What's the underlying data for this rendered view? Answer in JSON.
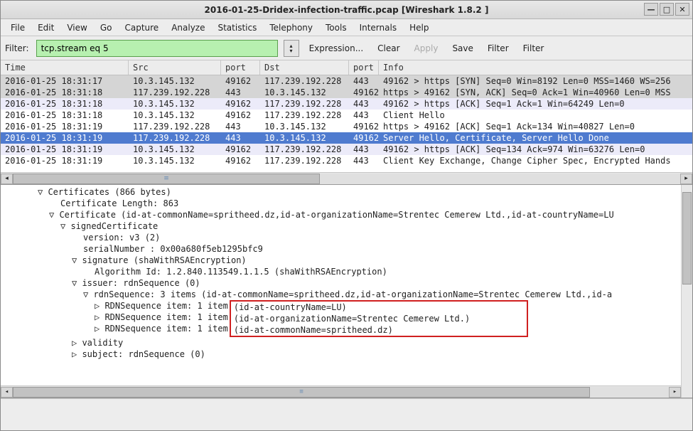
{
  "window": {
    "title": "2016-01-25-Dridex-infection-traffic.pcap   [Wireshark 1.8.2 ]"
  },
  "menu": {
    "items": [
      "File",
      "Edit",
      "View",
      "Go",
      "Capture",
      "Analyze",
      "Statistics",
      "Telephony",
      "Tools",
      "Internals",
      "Help"
    ]
  },
  "filter": {
    "label": "Filter:",
    "value": "tcp.stream eq 5",
    "expression": "Expression...",
    "clear": "Clear",
    "apply": "Apply",
    "save": "Save",
    "filter1": "Filter",
    "filter2": "Filter"
  },
  "packets": {
    "columns": [
      "Time",
      "Src",
      "port",
      "Dst",
      "port",
      "Info"
    ],
    "rows": [
      {
        "style": "row-gray",
        "c": [
          "2016-01-25 18:31:17",
          "10.3.145.132",
          "49162",
          "117.239.192.228",
          "443",
          "49162 > https [SYN] Seq=0 Win=8192 Len=0 MSS=1460 WS=256"
        ]
      },
      {
        "style": "row-gray",
        "c": [
          "2016-01-25 18:31:18",
          "117.239.192.228",
          "443",
          "10.3.145.132",
          "49162",
          "https > 49162 [SYN, ACK] Seq=0 Ack=1 Win=40960 Len=0 MSS"
        ]
      },
      {
        "style": "row-light",
        "c": [
          "2016-01-25 18:31:18",
          "10.3.145.132",
          "49162",
          "117.239.192.228",
          "443",
          "49162 > https [ACK] Seq=1 Ack=1 Win=64249 Len=0"
        ]
      },
      {
        "style": "row-white",
        "c": [
          "2016-01-25 18:31:18",
          "10.3.145.132",
          "49162",
          "117.239.192.228",
          "443",
          "Client Hello"
        ]
      },
      {
        "style": "row-white",
        "c": [
          "2016-01-25 18:31:19",
          "117.239.192.228",
          "443",
          "10.3.145.132",
          "49162",
          "https > 49162 [ACK] Seq=1 Ack=134 Win=40827 Len=0"
        ]
      },
      {
        "style": "row-sel",
        "c": [
          "2016-01-25 18:31:19",
          "117.239.192.228",
          "443",
          "10.3.145.132",
          "49162",
          "Server Hello, Certificate, Server Hello Done"
        ]
      },
      {
        "style": "row-light",
        "c": [
          "2016-01-25 18:31:19",
          "10.3.145.132",
          "49162",
          "117.239.192.228",
          "443",
          "49162 > https [ACK] Seq=134 Ack=974 Win=63276 Len=0"
        ]
      },
      {
        "style": "row-white",
        "c": [
          "2016-01-25 18:31:19",
          "10.3.145.132",
          "49162",
          "117.239.192.228",
          "443",
          "Client Key Exchange, Change Cipher Spec, Encrypted Hands"
        ]
      }
    ]
  },
  "tree": {
    "l0": "▽ Certificates (866 bytes)",
    "l1": "Certificate Length: 863",
    "l2": "▽ Certificate (id-at-commonName=spritheed.dz,id-at-organizationName=Strentec Cemerew Ltd.,id-at-countryName=LU",
    "l3": "▽ signedCertificate",
    "l4": "version: v3 (2)",
    "l5": "serialNumber : 0x00a680f5eb1295bfc9",
    "l6": "▽ signature (shaWithRSAEncryption)",
    "l7": "Algorithm Id: 1.2.840.113549.1.1.5 (shaWithRSAEncryption)",
    "l8": "▽ issuer: rdnSequence (0)",
    "l9": "▽ rdnSequence: 3 items (id-at-commonName=spritheed.dz,id-at-organizationName=Strentec Cemerew Ltd.,id-a",
    "l10a": "▷ RDNSequence item: 1 item",
    "l10b": "(id-at-countryName=LU)",
    "l11a": "▷ RDNSequence item: 1 item",
    "l11b": "(id-at-organizationName=Strentec Cemerew Ltd.)",
    "l12a": "▷ RDNSequence item: 1 item",
    "l12b": "(id-at-commonName=spritheed.dz)",
    "l13": "▷ validity",
    "l14": "▷ subject: rdnSequence (0)"
  },
  "winctl": {
    "min": "—",
    "max": "□",
    "close": "✕"
  }
}
